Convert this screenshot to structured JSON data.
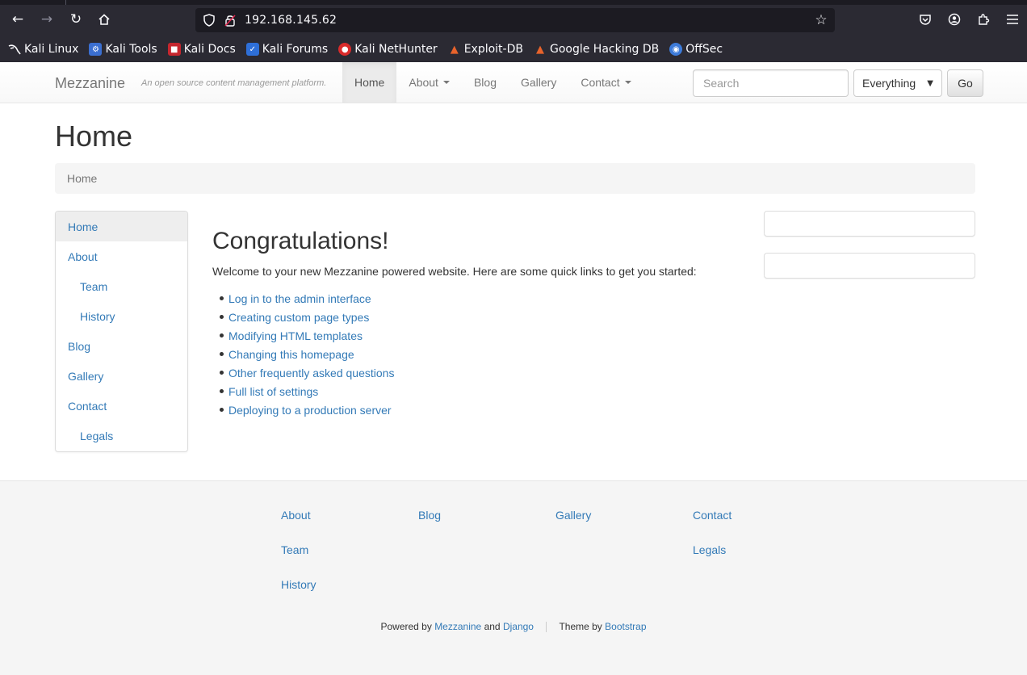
{
  "browser": {
    "url": "192.168.145.62",
    "bookmarks": [
      {
        "label": "Kali Linux",
        "icon": "kali-dragon-icon"
      },
      {
        "label": "Kali Tools",
        "icon": "kali-tools-icon"
      },
      {
        "label": "Kali Docs",
        "icon": "kali-docs-icon"
      },
      {
        "label": "Kali Forums",
        "icon": "kali-forums-icon"
      },
      {
        "label": "Kali NetHunter",
        "icon": "kali-nethunter-icon"
      },
      {
        "label": "Exploit-DB",
        "icon": "exploit-db-icon"
      },
      {
        "label": "Google Hacking DB",
        "icon": "ghdb-icon"
      },
      {
        "label": "OffSec",
        "icon": "offsec-icon"
      }
    ]
  },
  "navbar": {
    "brand": "Mezzanine",
    "tagline": "An open source content management platform.",
    "links": [
      {
        "label": "Home",
        "active": true,
        "dropdown": false
      },
      {
        "label": "About",
        "active": false,
        "dropdown": true
      },
      {
        "label": "Blog",
        "active": false,
        "dropdown": false
      },
      {
        "label": "Gallery",
        "active": false,
        "dropdown": false
      },
      {
        "label": "Contact",
        "active": false,
        "dropdown": true
      }
    ],
    "search_placeholder": "Search",
    "search_scope": "Everything",
    "go_label": "Go"
  },
  "page": {
    "title": "Home",
    "breadcrumb": "Home"
  },
  "leftnav": [
    {
      "label": "Home",
      "level": 0,
      "active": true
    },
    {
      "label": "About",
      "level": 0,
      "active": false
    },
    {
      "label": "Team",
      "level": 1,
      "active": false
    },
    {
      "label": "History",
      "level": 1,
      "active": false
    },
    {
      "label": "Blog",
      "level": 0,
      "active": false
    },
    {
      "label": "Gallery",
      "level": 0,
      "active": false
    },
    {
      "label": "Contact",
      "level": 0,
      "active": false
    },
    {
      "label": "Legals",
      "level": 1,
      "active": false
    }
  ],
  "main": {
    "heading": "Congratulations!",
    "intro": "Welcome to your new Mezzanine powered website. Here are some quick links to get you started:",
    "links": [
      "Log in to the admin interface",
      "Creating custom page types",
      "Modifying HTML templates",
      "Changing this homepage",
      "Other frequently asked questions",
      "Full list of settings",
      "Deploying to a production server"
    ]
  },
  "footer": {
    "columns": [
      [
        "About",
        "Team",
        "History"
      ],
      [
        "Blog"
      ],
      [
        "Gallery"
      ],
      [
        "Contact",
        "Legals"
      ]
    ],
    "powered_by": "Powered by",
    "mezzanine": "Mezzanine",
    "and": "and",
    "django": "Django",
    "theme_by": "Theme by",
    "bootstrap": "Bootstrap"
  },
  "colors": {
    "link": "#337ab7",
    "chrome_bg": "#2b2a33",
    "urlbar_bg": "#1c1b22"
  }
}
